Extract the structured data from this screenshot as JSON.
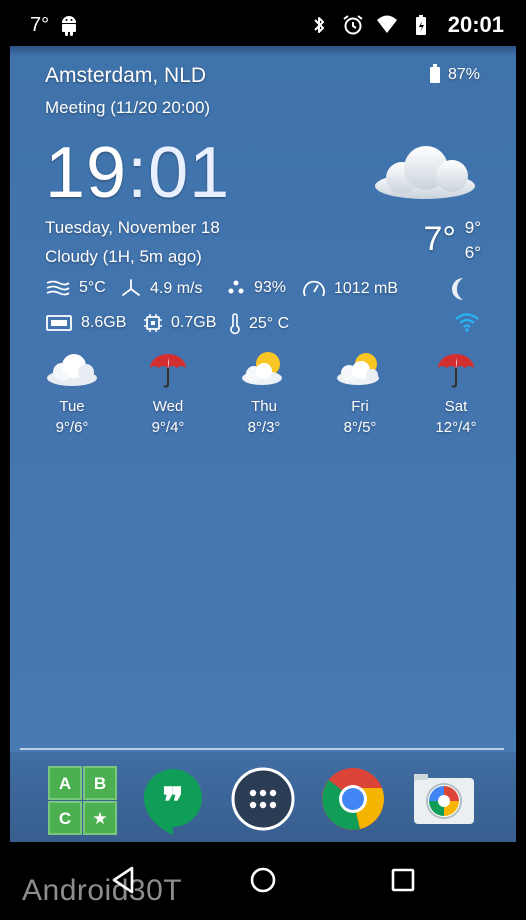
{
  "status_bar": {
    "temperature": "7°",
    "time": "20:01",
    "icons": [
      "android-icon",
      "bluetooth-icon",
      "alarm-icon",
      "wifi-icon",
      "battery-icon"
    ]
  },
  "widget": {
    "location": "Amsterdam, NLD",
    "event": "Meeting (11/20 20:00)",
    "battery": "87%",
    "clock_hours": "19",
    "clock_minutes": ":01",
    "date": "Tuesday, November 18",
    "condition": "Cloudy (1H, 5m ago)",
    "current_temp": "7°",
    "high": "9°",
    "low": "6°",
    "metrics": {
      "feels": "5°C",
      "wind": "4.9 m/s",
      "humidity": "93%",
      "pressure": "1012 mB",
      "memory": "8.6GB",
      "storage": "0.7GB",
      "cpu_temp": "25° C"
    },
    "forecast": [
      {
        "day": "Tue",
        "temps": "9°/6°",
        "icon": "cloud-icon"
      },
      {
        "day": "Wed",
        "temps": "9°/4°",
        "icon": "umbrella-icon"
      },
      {
        "day": "Thu",
        "temps": "8°/3°",
        "icon": "partly-sunny-icon"
      },
      {
        "day": "Fri",
        "temps": "8°/5°",
        "icon": "partly-sunny-icon"
      },
      {
        "day": "Sat",
        "temps": "12°/4°",
        "icon": "umbrella-icon"
      }
    ]
  },
  "dock": {
    "apps": [
      {
        "name": "ABC",
        "tile_labels": [
          "A",
          "B",
          "C",
          "★"
        ]
      },
      {
        "name": "Hangouts",
        "glyph": "❞"
      },
      {
        "name": "App drawer"
      },
      {
        "name": "Chrome"
      },
      {
        "name": "Camera"
      }
    ]
  },
  "watermark": "Android30T",
  "colors": {
    "wallpaper": "#4374ae",
    "hangouts_green": "#0f9d58",
    "abc_green": "#4caf50",
    "wifi_cyan": "#29b6f6"
  }
}
